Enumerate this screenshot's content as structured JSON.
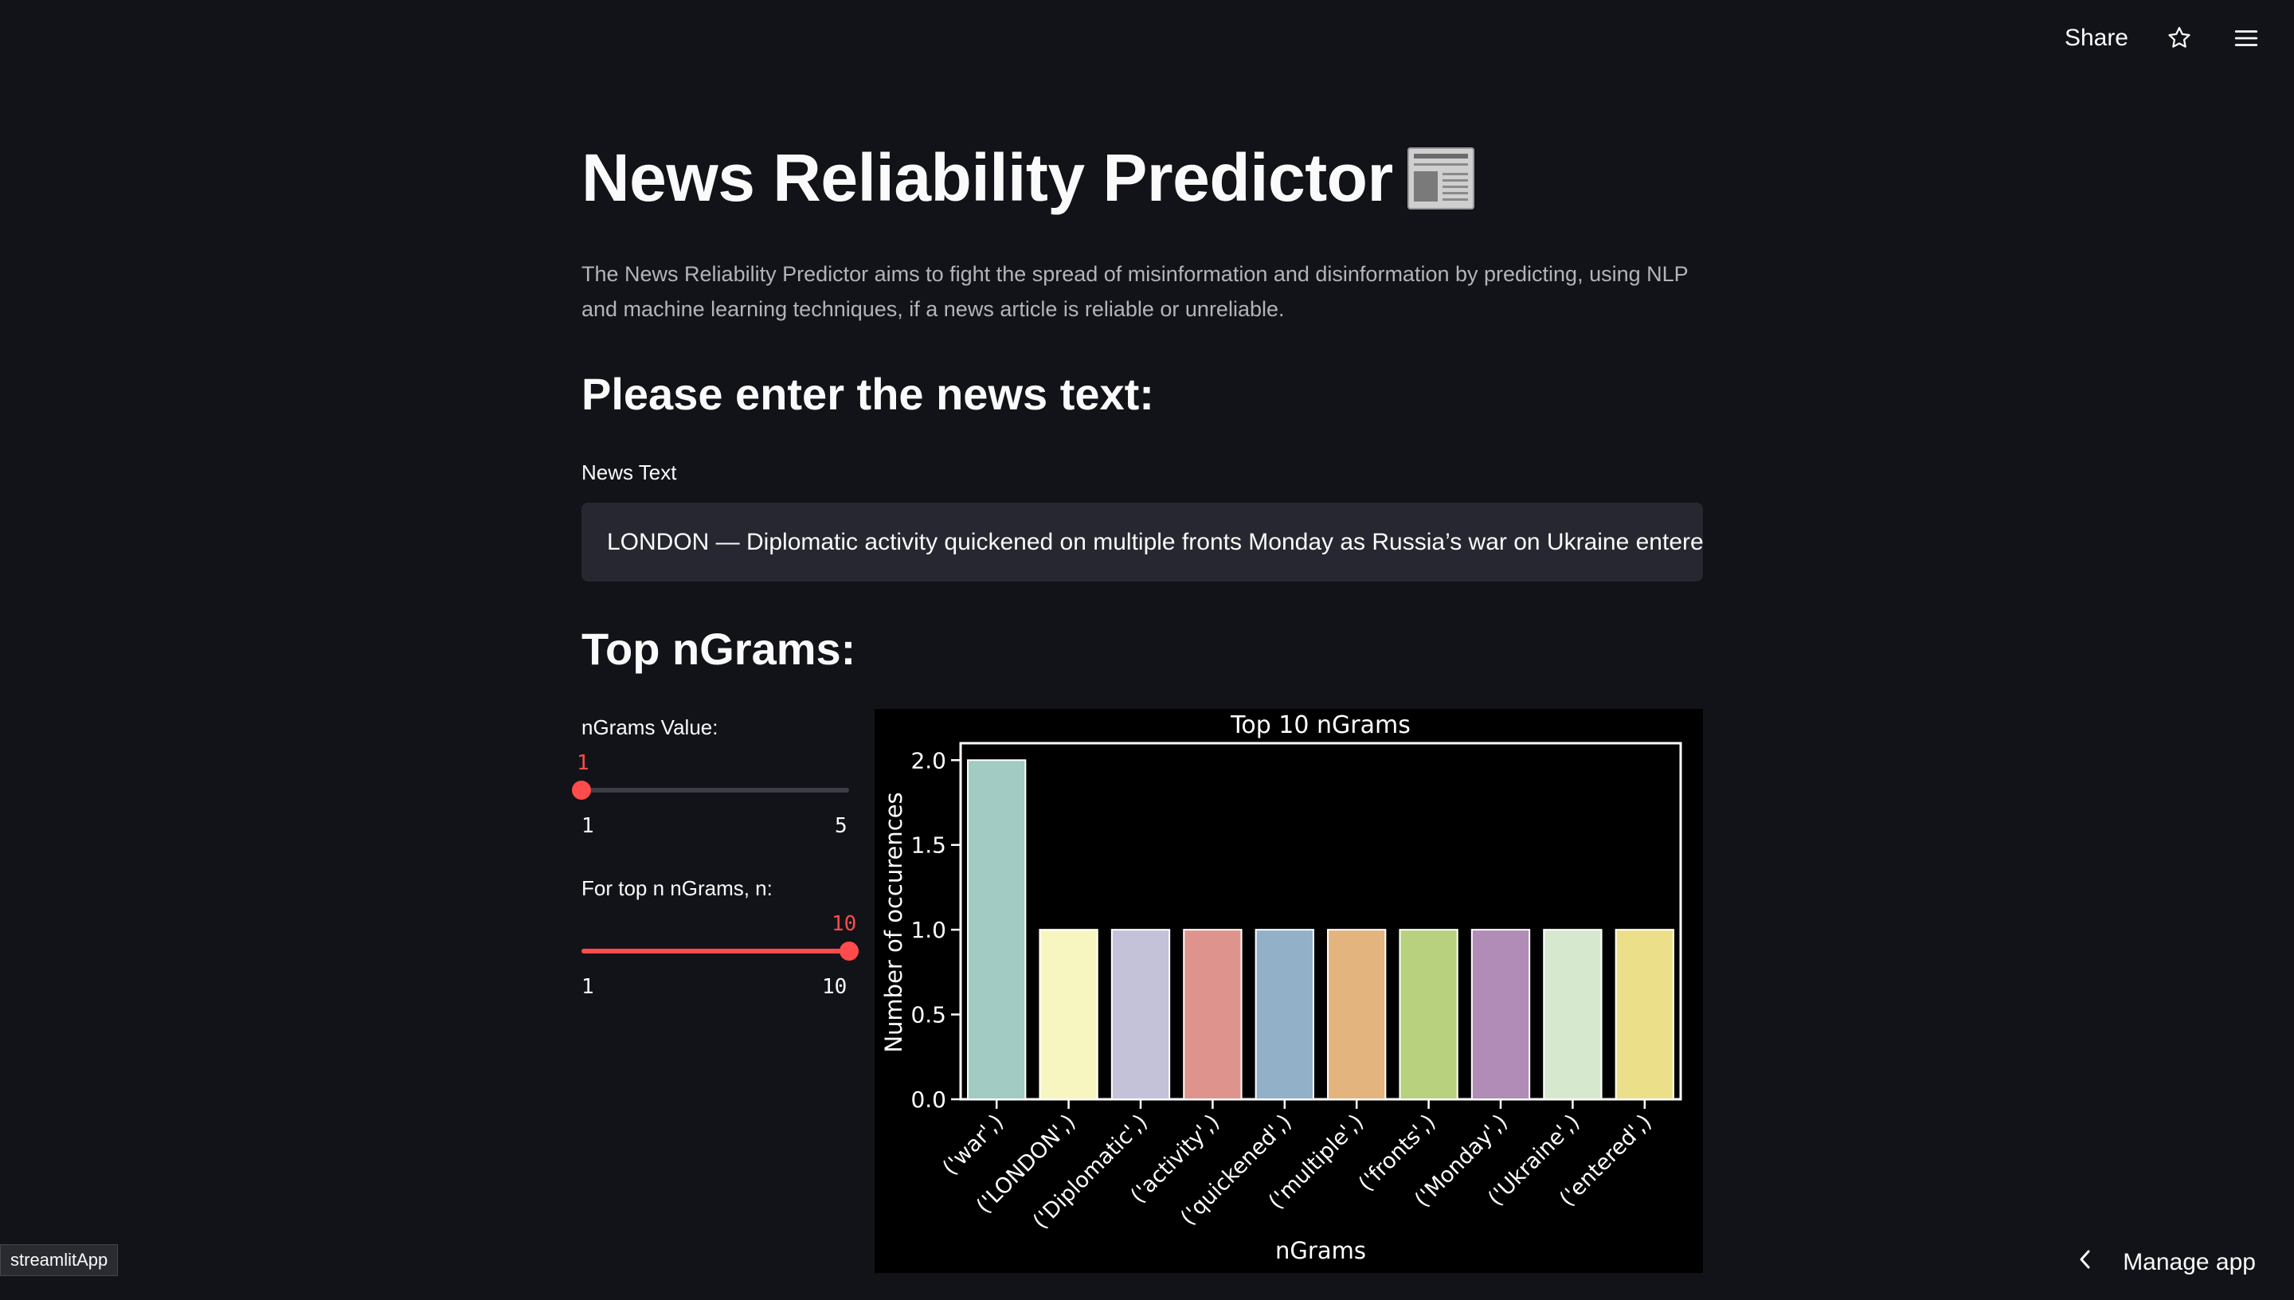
{
  "toolbar": {
    "share_label": "Share",
    "icons": [
      "star-icon",
      "hamburger-menu-icon"
    ]
  },
  "header": {
    "title": "News Reliability Predictor",
    "emoji_icon": "newspaper-icon",
    "description": "The News Reliability Predictor aims to fight the spread of misinformation and disinformation by predicting, using NLP and machine learning techniques, if a news article is reliable or unreliable."
  },
  "input_section": {
    "heading": "Please enter the news text:",
    "field_label": "News Text",
    "field_value": "LONDON — Diplomatic activity quickened on multiple fronts Monday as Russia’s war on Ukraine entered"
  },
  "ngrams_section": {
    "heading": "Top nGrams:",
    "slider_ngrams": {
      "label": "nGrams Value:",
      "value": "1",
      "min": "1",
      "max": "5",
      "fraction": 0
    },
    "slider_topn": {
      "label": "For top n nGrams, n:",
      "value": "10",
      "min": "1",
      "max": "10",
      "fraction": 1
    }
  },
  "chart_data": {
    "type": "bar",
    "title": "Top 10 nGrams",
    "xlabel": "nGrams",
    "ylabel": "Number of occurences",
    "categories": [
      "('war',)",
      "('LONDON',)",
      "('Diplomatic',)",
      "('activity',)",
      "('quickened',)",
      "('multiple',)",
      "('fronts',)",
      "('Monday',)",
      "('Ukraine',)",
      "('entered',)"
    ],
    "values": [
      2,
      1,
      1,
      1,
      1,
      1,
      1,
      1,
      1,
      1
    ],
    "colors": [
      "#a1cbc3",
      "#f8f6c0",
      "#c4c2d9",
      "#de948c",
      "#92b1c9",
      "#e3b47e",
      "#b8d17e",
      "#b18cb6",
      "#d6e9ce",
      "#ebdf8a"
    ],
    "yticks": [
      "0.0",
      "0.5",
      "1.0",
      "1.5",
      "2.0"
    ],
    "ylim": [
      0,
      2.1
    ],
    "grid": false,
    "background": "#000000"
  },
  "footer": {
    "badge": "streamlitApp",
    "manage_label": "Manage app"
  }
}
